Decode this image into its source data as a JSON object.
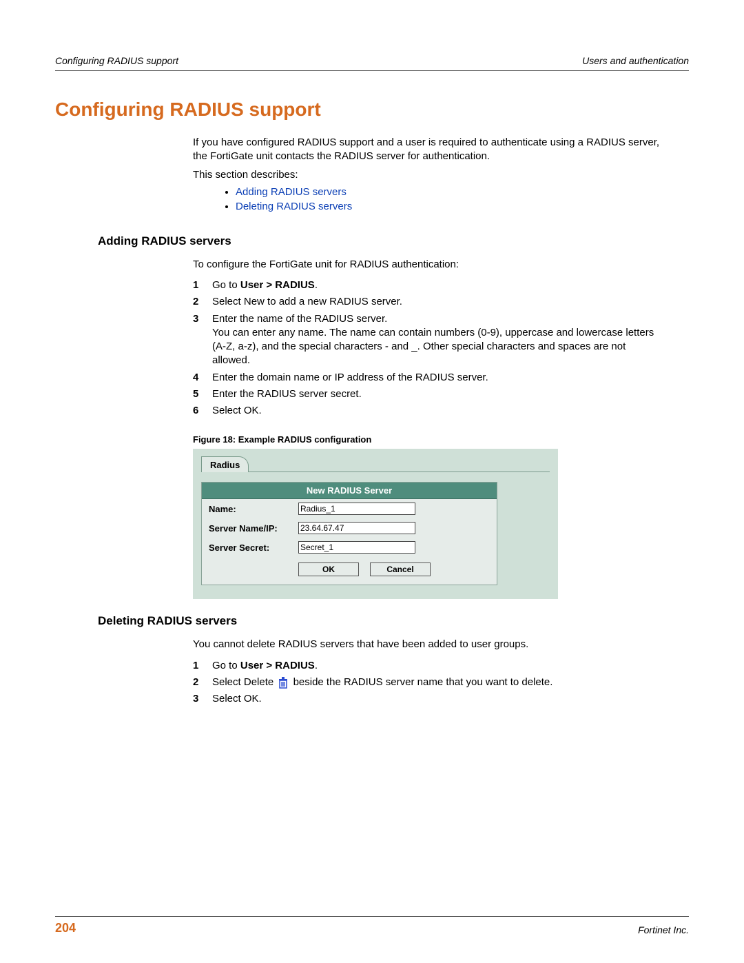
{
  "header": {
    "left": "Configuring RADIUS support",
    "right": "Users and authentication"
  },
  "title": "Configuring RADIUS support",
  "intro1": "If you have configured RADIUS support and a user is required to authenticate using a RADIUS server, the FortiGate unit contacts the RADIUS server for authentication.",
  "intro2": "This section describes:",
  "links": {
    "add": "Adding RADIUS servers",
    "delete": "Deleting RADIUS servers"
  },
  "section_add": {
    "heading": "Adding RADIUS servers",
    "intro": "To configure the FortiGate unit for RADIUS authentication:",
    "steps": {
      "s1a": "Go to ",
      "s1b": "User > RADIUS",
      "s1c": ".",
      "s2": "Select New to add a new RADIUS server.",
      "s3": "Enter the name of the RADIUS server.",
      "s3_note": "You can enter any name. The name can contain numbers (0-9), uppercase and lowercase letters (A-Z, a-z), and the special characters - and _. Other special characters and spaces are not allowed.",
      "s4": "Enter the domain name or IP address of the RADIUS server.",
      "s5": "Enter the RADIUS server secret.",
      "s6": "Select OK."
    }
  },
  "figure": {
    "caption": "Figure 18: Example RADIUS configuration",
    "tab": "Radius",
    "form_title": "New RADIUS Server",
    "name_label": "Name:",
    "name_value": "Radius_1",
    "server_label": "Server Name/IP:",
    "server_value": "23.64.67.47",
    "secret_label": "Server Secret:",
    "secret_value": "Secret_1",
    "ok": "OK",
    "cancel": "Cancel"
  },
  "section_del": {
    "heading": "Deleting RADIUS servers",
    "intro": "You cannot delete RADIUS servers that have been added to user groups.",
    "steps": {
      "s1a": "Go to ",
      "s1b": "User > RADIUS",
      "s1c": ".",
      "s2a": "Select Delete ",
      "s2b": " beside the RADIUS server name that you want to delete.",
      "s3": "Select OK."
    }
  },
  "footer": {
    "page": "204",
    "right": "Fortinet Inc."
  }
}
